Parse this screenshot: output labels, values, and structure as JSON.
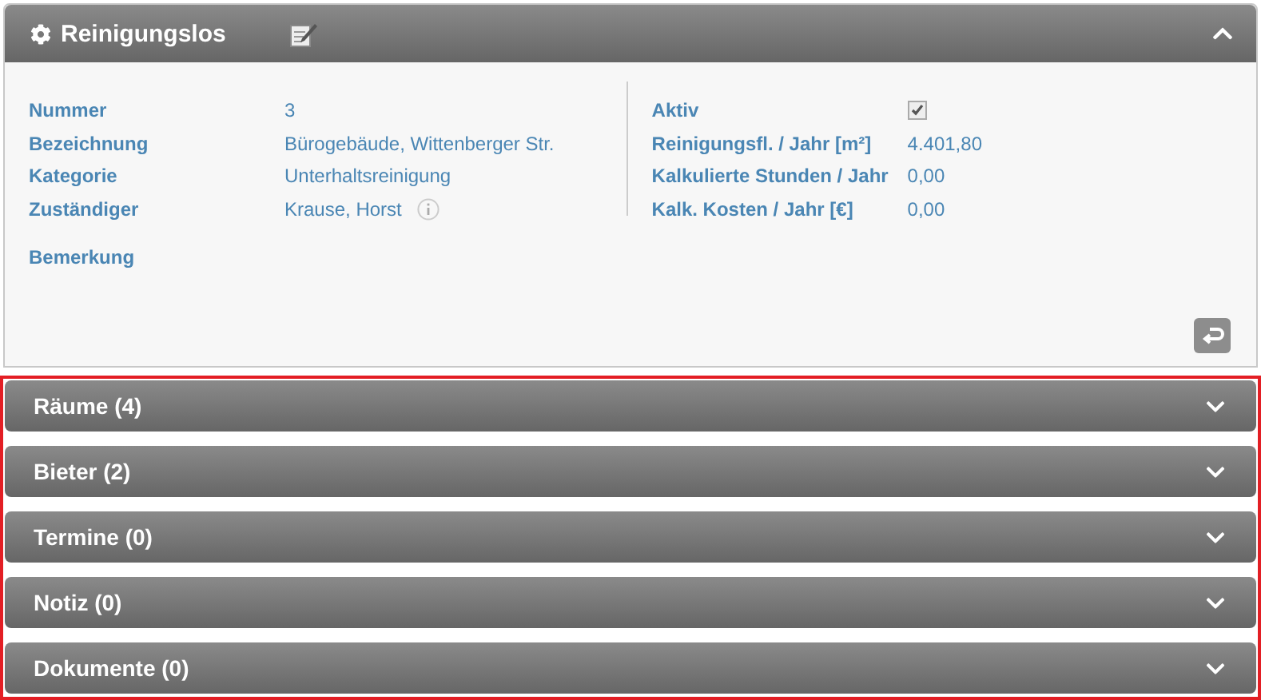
{
  "panel": {
    "title": "Reinigungslos",
    "expanded": true
  },
  "left_fields": [
    {
      "label": "Nummer",
      "value": "3"
    },
    {
      "label": "Bezeichnung",
      "value": "Bürogebäude, Wittenberger Str."
    },
    {
      "label": "Kategorie",
      "value": "Unterhaltsreinigung"
    },
    {
      "label": "Zuständiger",
      "value": "Krause, Horst",
      "info": true
    }
  ],
  "remark": {
    "label": "Bemerkung"
  },
  "right_fields": [
    {
      "label": "Aktiv",
      "kind": "checkbox",
      "checked": true
    },
    {
      "label": "Reinigungsfl. / Jahr [m²]",
      "kind": "text",
      "value": "4.401,80"
    },
    {
      "label": "Kalkulierte Stunden / Jahr",
      "kind": "text",
      "value": "0,00"
    },
    {
      "label": "Kalk. Kosten / Jahr [€]",
      "kind": "text",
      "value": "0,00"
    }
  ],
  "sections": [
    {
      "title": "Räume (4)",
      "expanded": false
    },
    {
      "title": "Bieter (2)",
      "expanded": false
    },
    {
      "title": "Termine (0)",
      "expanded": false
    },
    {
      "title": "Notiz (0)",
      "expanded": false
    },
    {
      "title": "Dokumente (0)",
      "expanded": false
    }
  ]
}
